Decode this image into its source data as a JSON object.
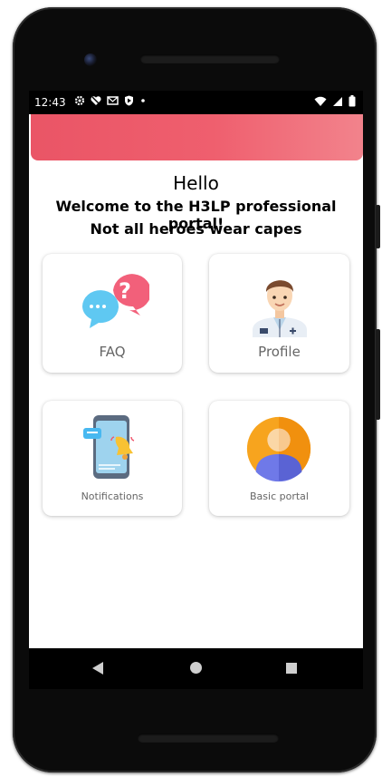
{
  "status_bar": {
    "time": "12:43",
    "left_icons": [
      "gear-icon",
      "no-signal-heart-icon",
      "mail-icon",
      "shield-icon",
      "dot-icon"
    ],
    "right_icons": [
      "wifi-icon",
      "signal-icon",
      "battery-icon"
    ]
  },
  "app_bar": {
    "colors": [
      "#ea5566",
      "#f2838c"
    ]
  },
  "header": {
    "greeting": "Hello",
    "welcome": "Welcome to the H3LP professional portal!",
    "tagline": "Not all heroes wear capes"
  },
  "cards": [
    {
      "label": "FAQ",
      "icon": "faq-chat-bubbles-icon"
    },
    {
      "label": "Profile",
      "icon": "doctor-avatar-icon"
    },
    {
      "label": "Notifications",
      "icon": "phone-notification-bell-icon"
    },
    {
      "label": "Basic portal",
      "icon": "user-avatar-icon"
    }
  ],
  "nav_bar": {
    "buttons": [
      "back-icon",
      "home-icon",
      "recents-icon"
    ]
  }
}
